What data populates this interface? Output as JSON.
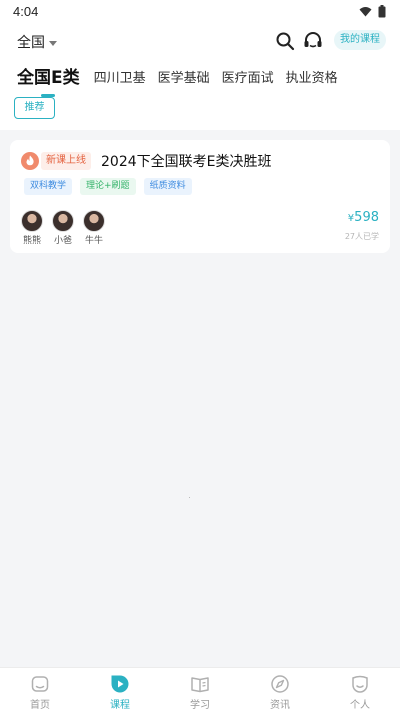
{
  "status_bar": {
    "time": "4:04"
  },
  "header": {
    "region": "全国",
    "my_courses_label": "我的课程",
    "icons": [
      "search-icon",
      "headset-icon"
    ]
  },
  "tabs": [
    {
      "label": "全国E类",
      "active": true
    },
    {
      "label": "四川卫基",
      "active": false
    },
    {
      "label": "医学基础",
      "active": false
    },
    {
      "label": "医疗面试",
      "active": false
    },
    {
      "label": "执业资格",
      "active": false
    }
  ],
  "filter": {
    "label": "推荐"
  },
  "course": {
    "badge": "新课上线",
    "title": "2024下全国联考E类决胜班",
    "tags": [
      "双科教学",
      "理论+刷题",
      "纸质资料"
    ],
    "teachers": [
      "熊熊",
      "小爸",
      "牛牛"
    ],
    "currency": "¥",
    "price": "598",
    "enrolled": "27人已学"
  },
  "bottom_nav": [
    {
      "label": "首页",
      "icon": "home-icon",
      "active": false
    },
    {
      "label": "课程",
      "icon": "course-play-icon",
      "active": true
    },
    {
      "label": "学习",
      "icon": "book-icon",
      "active": false
    },
    {
      "label": "资讯",
      "icon": "compass-icon",
      "active": false
    },
    {
      "label": "个人",
      "icon": "profile-icon",
      "active": false
    }
  ],
  "colors": {
    "accent": "#2bb1c2",
    "badge": "#e4623f"
  }
}
